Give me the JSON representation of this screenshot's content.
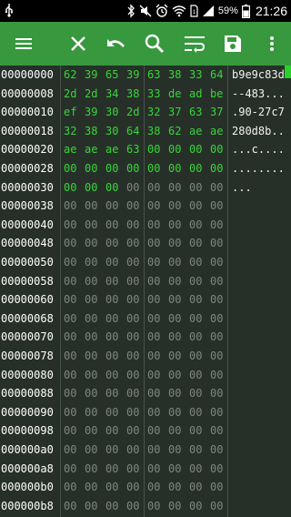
{
  "colors": {
    "toolbar": "#38983e",
    "background": "#263029",
    "byte_highlight": "#3ad43a",
    "byte_dim": "#7e857f",
    "scroll_thumb": "#2bd12b"
  },
  "status_bar": {
    "battery_percent": "59%",
    "time": "21:26",
    "icons": [
      "usb-icon",
      "bluetooth-icon",
      "mute-icon",
      "alarm-icon",
      "wifi-icon",
      "sim-icon",
      "signal-icon",
      "battery-icon"
    ]
  },
  "toolbar": {
    "icons": [
      "menu-icon",
      "close-icon",
      "undo-icon",
      "search-icon",
      "wrap-text-icon",
      "save-icon",
      "overflow-menu-icon"
    ]
  },
  "hex_rows": [
    {
      "addr": "00000000",
      "bytes": [
        "62",
        "39",
        "65",
        "39",
        "63",
        "38",
        "33",
        "64"
      ],
      "ascii": "b9e9c83d"
    },
    {
      "addr": "00000008",
      "bytes": [
        "2d",
        "2d",
        "34",
        "38",
        "33",
        "de",
        "ad",
        "be"
      ],
      "ascii": "--483..."
    },
    {
      "addr": "00000010",
      "bytes": [
        "ef",
        "39",
        "30",
        "2d",
        "32",
        "37",
        "63",
        "37"
      ],
      "ascii": ".90-27c7"
    },
    {
      "addr": "00000018",
      "bytes": [
        "32",
        "38",
        "30",
        "64",
        "38",
        "62",
        "ae",
        "ae"
      ],
      "ascii": "280d8b.."
    },
    {
      "addr": "00000020",
      "bytes": [
        "ae",
        "ae",
        "ae",
        "63",
        "00",
        "00",
        "00",
        "00"
      ],
      "ascii": "...c...."
    },
    {
      "addr": "00000028",
      "bytes": [
        "00",
        "00",
        "00",
        "00",
        "00",
        "00",
        "00",
        "00"
      ],
      "ascii": "........"
    },
    {
      "addr": "00000030",
      "bytes": [
        "00",
        "00",
        "00",
        "00",
        "00",
        "00",
        "00",
        "00"
      ],
      "ascii": "...",
      "green_count": 3
    },
    {
      "addr": "00000038",
      "bytes": [
        "00",
        "00",
        "00",
        "00",
        "00",
        "00",
        "00",
        "00"
      ],
      "ascii": ""
    },
    {
      "addr": "00000040",
      "bytes": [
        "00",
        "00",
        "00",
        "00",
        "00",
        "00",
        "00",
        "00"
      ],
      "ascii": ""
    },
    {
      "addr": "00000048",
      "bytes": [
        "00",
        "00",
        "00",
        "00",
        "00",
        "00",
        "00",
        "00"
      ],
      "ascii": ""
    },
    {
      "addr": "00000050",
      "bytes": [
        "00",
        "00",
        "00",
        "00",
        "00",
        "00",
        "00",
        "00"
      ],
      "ascii": ""
    },
    {
      "addr": "00000058",
      "bytes": [
        "00",
        "00",
        "00",
        "00",
        "00",
        "00",
        "00",
        "00"
      ],
      "ascii": ""
    },
    {
      "addr": "00000060",
      "bytes": [
        "00",
        "00",
        "00",
        "00",
        "00",
        "00",
        "00",
        "00"
      ],
      "ascii": ""
    },
    {
      "addr": "00000068",
      "bytes": [
        "00",
        "00",
        "00",
        "00",
        "00",
        "00",
        "00",
        "00"
      ],
      "ascii": ""
    },
    {
      "addr": "00000070",
      "bytes": [
        "00",
        "00",
        "00",
        "00",
        "00",
        "00",
        "00",
        "00"
      ],
      "ascii": ""
    },
    {
      "addr": "00000078",
      "bytes": [
        "00",
        "00",
        "00",
        "00",
        "00",
        "00",
        "00",
        "00"
      ],
      "ascii": ""
    },
    {
      "addr": "00000080",
      "bytes": [
        "00",
        "00",
        "00",
        "00",
        "00",
        "00",
        "00",
        "00"
      ],
      "ascii": ""
    },
    {
      "addr": "00000088",
      "bytes": [
        "00",
        "00",
        "00",
        "00",
        "00",
        "00",
        "00",
        "00"
      ],
      "ascii": ""
    },
    {
      "addr": "00000090",
      "bytes": [
        "00",
        "00",
        "00",
        "00",
        "00",
        "00",
        "00",
        "00"
      ],
      "ascii": ""
    },
    {
      "addr": "00000098",
      "bytes": [
        "00",
        "00",
        "00",
        "00",
        "00",
        "00",
        "00",
        "00"
      ],
      "ascii": ""
    },
    {
      "addr": "000000a0",
      "bytes": [
        "00",
        "00",
        "00",
        "00",
        "00",
        "00",
        "00",
        "00"
      ],
      "ascii": ""
    },
    {
      "addr": "000000a8",
      "bytes": [
        "00",
        "00",
        "00",
        "00",
        "00",
        "00",
        "00",
        "00"
      ],
      "ascii": ""
    },
    {
      "addr": "000000b0",
      "bytes": [
        "00",
        "00",
        "00",
        "00",
        "00",
        "00",
        "00",
        "00"
      ],
      "ascii": ""
    },
    {
      "addr": "000000b8",
      "bytes": [
        "00",
        "00",
        "00",
        "00",
        "00",
        "00",
        "00",
        "00"
      ],
      "ascii": ""
    }
  ]
}
